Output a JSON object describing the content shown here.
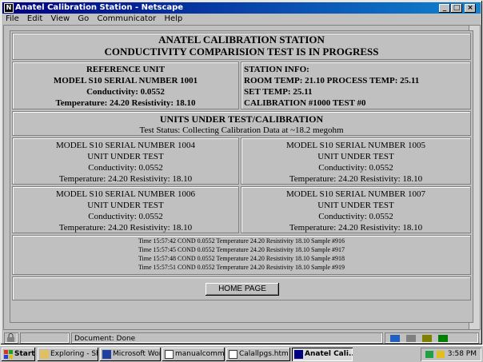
{
  "window": {
    "title": "Anatel Calibration Station - Netscape",
    "menu": [
      "File",
      "Edit",
      "View",
      "Go",
      "Communicator",
      "Help"
    ]
  },
  "page": {
    "header": {
      "line1": "ANATEL CALIBRATION STATION",
      "line2": "CONDUCTIVITY COMPARISION TEST IS IN PROGRESS"
    },
    "reference": {
      "title": "REFERENCE UNIT",
      "model": "MODEL S10 SERIAL NUMBER 1001",
      "conductivity": "Conductivity: 0.0552",
      "temp": "Temperature: 24.20 Resistivity: 18.10"
    },
    "station": {
      "title": "STATION INFO:",
      "room": "ROOM TEMP: 21.10 PROCESS TEMP: 25.11",
      "set": "SET TEMP: 25.11",
      "calibration": "CALIBRATION #1000 TEST #0"
    },
    "uut_header": {
      "title": "UNITS UNDER TEST/CALIBRATION",
      "status": "Test Status: Collecting Calibration Data at ~18.2 megohm"
    },
    "units": [
      {
        "model": "MODEL S10 SERIAL NUMBER 1004",
        "label": "UNIT UNDER TEST",
        "conductivity": "Conductivity: 0.0552",
        "temp": "Temperature: 24.20 Resistivity: 18.10"
      },
      {
        "model": "MODEL S10 SERIAL NUMBER 1005",
        "label": "UNIT UNDER TEST",
        "conductivity": "Conductivity: 0.0552",
        "temp": "Temperature: 24.20 Resistivity: 18.10"
      },
      {
        "model": "MODEL S10 SERIAL NUMBER 1006",
        "label": "UNIT UNDER TEST",
        "conductivity": "Conductivity: 0.0552",
        "temp": "Temperature: 24.20 Resistivity: 18.10"
      },
      {
        "model": "MODEL S10 SERIAL NUMBER 1007",
        "label": "UNIT UNDER TEST",
        "conductivity": "Conductivity: 0.0552",
        "temp": "Temperature: 24.20 Resistivity: 18.10"
      }
    ],
    "log": [
      "Time 15:57:42 COND 0.0552 Temperature 24.20 Resistivity 18.10 Sample #916",
      "Time 15:57:45 COND 0.0552 Temperature 24.20 Resistivity 18.10 Sample #917",
      "Time 15:57:48 COND 0.0552 Temperature 24.20 Resistivity 18.10 Sample #918",
      "Time 15:57:51 COND 0.0552 Temperature 24.20 Resistivity 18.10 Sample #919"
    ],
    "home_button": "HOME PAGE"
  },
  "statusbar": {
    "text": "Document: Done"
  },
  "taskbar": {
    "start": "Start",
    "items": [
      "Exploring - Shi...",
      "Microsoft Word",
      "manualcomma...",
      "Calallpgs.htm -...",
      "Anatel Cali..."
    ],
    "clock": "3:58 PM"
  },
  "colors": {
    "titlebar": "#000080",
    "chrome": "#c0c0c0",
    "desktop": "#008080"
  }
}
